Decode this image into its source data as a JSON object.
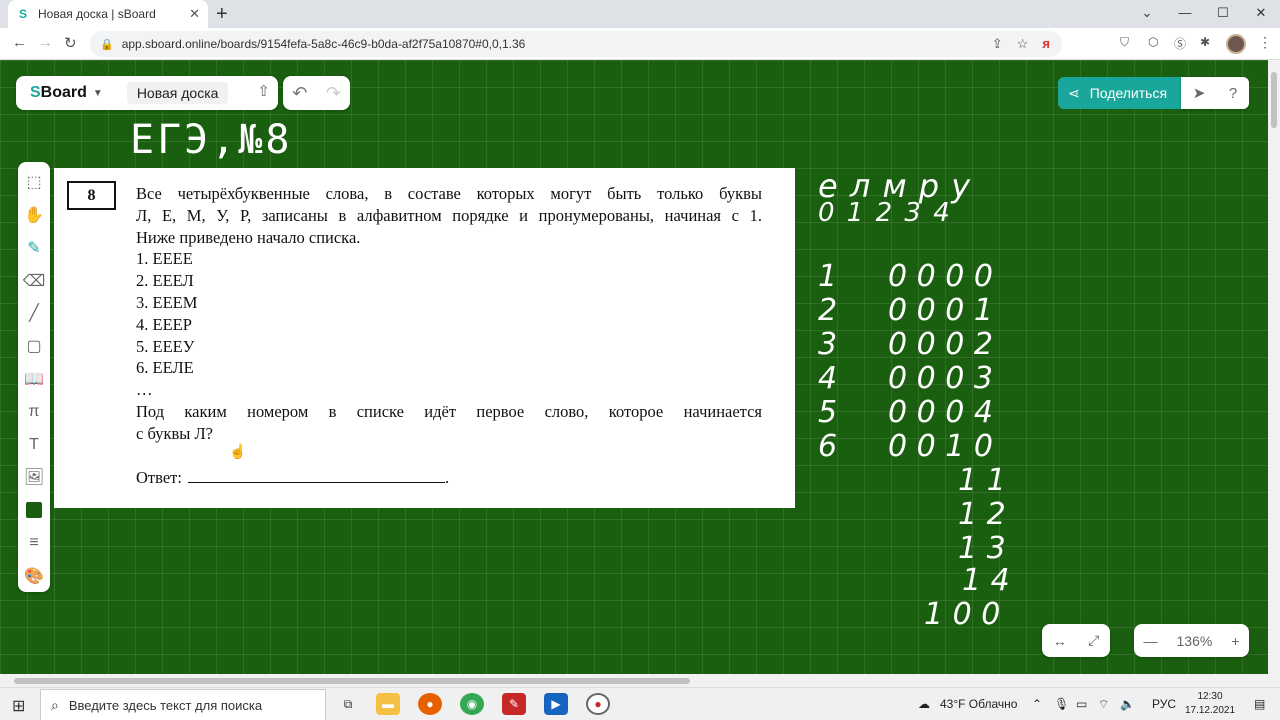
{
  "browser": {
    "tab_title": "Новая доска | sBoard",
    "url": "app.sboard.online/boards/9154fefa-5a8c-46c9-b0da-af2f75a10870#0,0,1.36",
    "ya_label": "я"
  },
  "app": {
    "logo": "Board",
    "logo_s": "S",
    "board_name": "Новая доска",
    "share_label": "Поделиться",
    "zoom_level": "136%",
    "accent_color": "#1aa79b",
    "board_color": "#1a5f0f"
  },
  "tools": [
    {
      "name": "select-tool",
      "icon": "⬚"
    },
    {
      "name": "hand-tool",
      "icon": "✋"
    },
    {
      "name": "pen-tool",
      "icon": "✎"
    },
    {
      "name": "eraser-tool",
      "icon": "⌫"
    },
    {
      "name": "line-tool",
      "icon": "╱"
    },
    {
      "name": "shape-tool",
      "icon": "▢"
    },
    {
      "name": "book-tool",
      "icon": "📖"
    },
    {
      "name": "formula-tool",
      "icon": "π"
    },
    {
      "name": "text-tool",
      "icon": "T"
    },
    {
      "name": "image-tool",
      "icon": "🖼"
    },
    {
      "name": "color-swatch",
      "icon": ""
    },
    {
      "name": "stroke-width-tool",
      "icon": "≡"
    },
    {
      "name": "palette-tool",
      "icon": "🎨"
    }
  ],
  "task": {
    "number": "8",
    "intro_lines": [
      "Все четырёхбуквенные слова, в составе которых могут быть только буквы",
      "Л, Е, М, У, Р, записаны в алфавитном порядке и пронумерованы, начиная с 1."
    ],
    "intro_last": "Ниже приведено начало списка.",
    "list": [
      "1.  ЕЕЕЕ",
      "2.  ЕЕЕЛ",
      "3.  ЕЕЕМ",
      "4.  ЕЕЕР",
      "5.  ЕЕЕУ",
      "6.  ЕЕЛЕ"
    ],
    "ellipsis": "…",
    "question_line1": "Под каким номером в списке идёт первое слово, которое начинается",
    "question_line2": "с буквы Л?",
    "answer_label": "Ответ:",
    "answer_end": "."
  },
  "handwriting": {
    "title": "ЕГЭ,№8",
    "letters": "е  л  м  р  у",
    "digits": "0  1  2  3  4",
    "rows": [
      {
        "n": "1",
        "code": "0 0 0 0"
      },
      {
        "n": "2",
        "code": "0 0 0 1"
      },
      {
        "n": "3",
        "code": "0 0 0 2"
      },
      {
        "n": "4",
        "code": "0 0 0 3"
      },
      {
        "n": "5",
        "code": "0 0 0 4"
      },
      {
        "n": "6",
        "code": "0 0 1 0"
      }
    ],
    "extra": [
      "1 1",
      "1 2",
      "1 3",
      "1 4",
      "1 0 0"
    ]
  },
  "taskbar": {
    "search_placeholder": "Введите здесь текст для поиска",
    "weather": "43°F  Облачно",
    "lang": "РУС",
    "time": "12:30",
    "date": "17.12.2021"
  }
}
